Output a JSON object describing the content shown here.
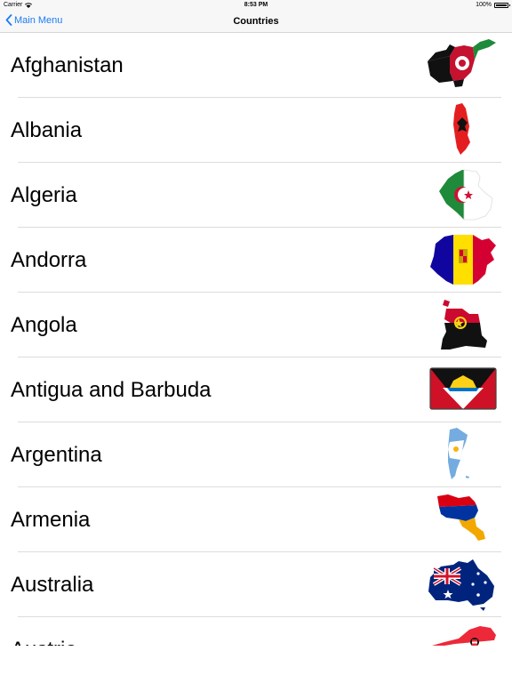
{
  "status_bar": {
    "carrier": "Carrier",
    "time": "8:53 PM",
    "battery": "100%"
  },
  "nav": {
    "back_label": "Main Menu",
    "title": "Countries"
  },
  "countries": [
    {
      "name": "Afghanistan",
      "flag": "afghanistan-flag-map"
    },
    {
      "name": "Albania",
      "flag": "albania-flag-map"
    },
    {
      "name": "Algeria",
      "flag": "algeria-flag-map"
    },
    {
      "name": "Andorra",
      "flag": "andorra-flag-map"
    },
    {
      "name": "Angola",
      "flag": "angola-flag-map"
    },
    {
      "name": "Antigua and Barbuda",
      "flag": "antigua-and-barbuda-flag"
    },
    {
      "name": "Argentina",
      "flag": "argentina-flag-map"
    },
    {
      "name": "Armenia",
      "flag": "armenia-flag-map"
    },
    {
      "name": "Australia",
      "flag": "australia-flag-map"
    },
    {
      "name": "Austria",
      "flag": "austria-flag-map"
    }
  ],
  "colors": {
    "accent": "#1a7cf5",
    "separator": "#dcdcdc",
    "bar": "#f7f7f7"
  }
}
